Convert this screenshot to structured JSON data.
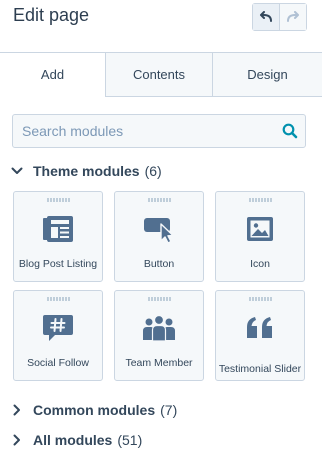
{
  "header": {
    "title": "Edit page",
    "undo_icon": "undo-icon",
    "redo_icon": "redo-icon"
  },
  "tabs": [
    {
      "label": "Add",
      "active": true
    },
    {
      "label": "Contents",
      "active": false
    },
    {
      "label": "Design",
      "active": false
    }
  ],
  "search": {
    "placeholder": "Search modules",
    "value": "",
    "icon": "search-icon"
  },
  "sections": {
    "theme": {
      "name": "Theme modules",
      "count": "(6)",
      "expanded": true
    },
    "common": {
      "name": "Common modules",
      "count": "(7)",
      "expanded": false
    },
    "all": {
      "name": "All modules",
      "count": "(51)",
      "expanded": false
    }
  },
  "modules": [
    {
      "label": "Blog Post Listing",
      "icon": "blog-listing-icon"
    },
    {
      "label": "Button",
      "icon": "button-cursor-icon"
    },
    {
      "label": "Icon",
      "icon": "image-icon"
    },
    {
      "label": "Social Follow",
      "icon": "hashtag-chat-icon"
    },
    {
      "label": "Team Member",
      "icon": "team-icon"
    },
    {
      "label": "Testimonial Slider",
      "icon": "quote-icon"
    }
  ],
  "colors": {
    "icon": "#516f90",
    "accent": "#0091ae",
    "text": "#33475b",
    "border": "#cbd6e2",
    "card_bg": "#f5f8fa"
  }
}
